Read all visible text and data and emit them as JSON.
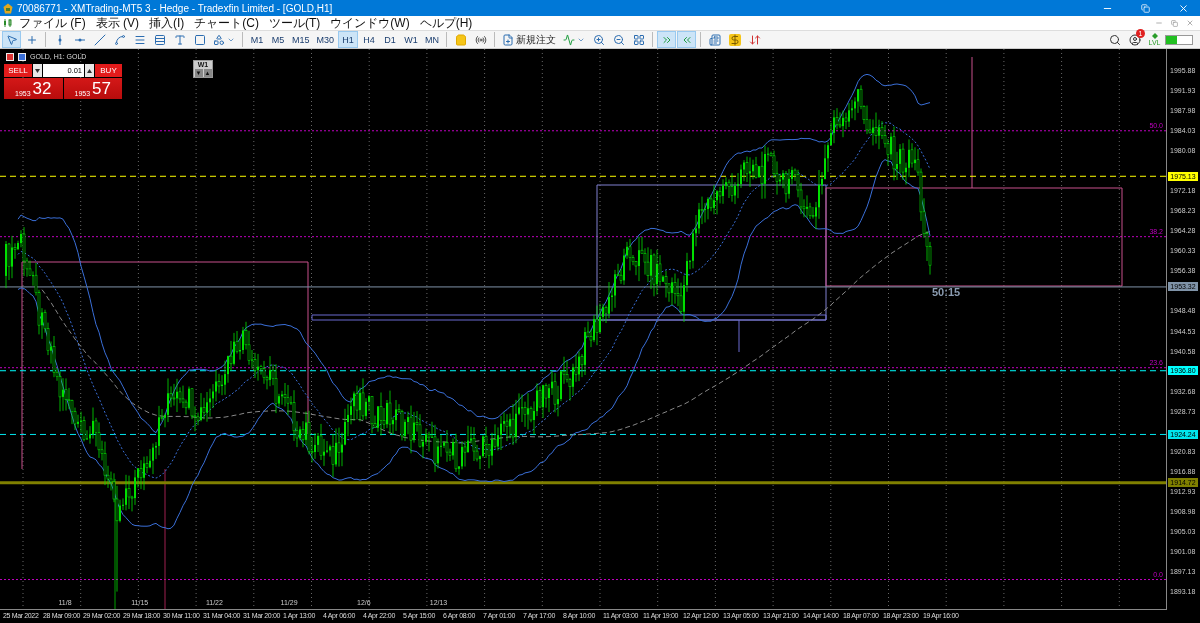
{
  "window": {
    "title": "70086771 - XMTrading-MT5 3 - Hedge - Tradexfin Limited - [GOLD,H1]"
  },
  "menu": [
    "ファイル (F)",
    "表示 (V)",
    "挿入(I)",
    "チャート(C)",
    "ツール(T)",
    "ウインドウ(W)",
    "ヘルプ(H)"
  ],
  "toolbar": {
    "tools": [
      {
        "kind": "cursor",
        "selected": true
      },
      {
        "kind": "crosshair",
        "selected": false
      },
      {
        "kind": "vertical-line",
        "selected": false
      },
      {
        "kind": "horizontal-line",
        "selected": false
      },
      {
        "kind": "trend-line",
        "selected": false
      },
      {
        "kind": "curve",
        "selected": false
      },
      {
        "kind": "channel",
        "selected": false
      },
      {
        "kind": "fibonacci",
        "selected": false
      },
      {
        "kind": "text",
        "selected": false
      },
      {
        "kind": "rectangle",
        "selected": false
      },
      {
        "kind": "shapes",
        "selected": false
      }
    ],
    "timeframes": [
      {
        "label": "M1",
        "selected": false
      },
      {
        "label": "M5",
        "selected": false
      },
      {
        "label": "M15",
        "selected": false
      },
      {
        "label": "M30",
        "selected": false
      },
      {
        "label": "H1",
        "selected": true
      },
      {
        "label": "H4",
        "selected": false
      },
      {
        "label": "D1",
        "selected": false
      },
      {
        "label": "W1",
        "selected": false
      },
      {
        "label": "MN",
        "selected": false
      }
    ],
    "new_order": "新規注文",
    "chart_tools": [
      {
        "kind": "auto-scroll",
        "selected": true
      },
      {
        "kind": "chart-shift",
        "selected": true
      }
    ],
    "notifications": "1",
    "lvl": "LVL"
  },
  "chart": {
    "header": "GOLD, H1: GOLD",
    "trade_panel": {
      "sell": "SELL",
      "buy": "BUY",
      "lot": "0.01",
      "sell_price": "1953",
      "sell_pips": "32",
      "buy_price": "1953",
      "buy_pips": "57"
    },
    "period_button": {
      "label": "W1",
      "down": "▼",
      "up": "▲"
    },
    "countdown": "50:15",
    "fibo_levels": [
      "50.0",
      "38.2",
      "23.6",
      "0.0"
    ],
    "price_lines": [
      {
        "label": "1975.13",
        "color": "#ffff00",
        "kind": "dashed"
      },
      {
        "label": "1953.32",
        "color": "#7f93a8",
        "kind": "solid"
      },
      {
        "label": "1936.80",
        "color": "#00ffff",
        "kind": "dashed"
      },
      {
        "label": "1924.24",
        "color": "#00e5ee",
        "kind": "dashed"
      },
      {
        "label": "1914.72",
        "color": "#808000",
        "kind": "thick"
      }
    ],
    "price_axis": [
      "1995.88",
      "1991.93",
      "1987.98",
      "1984.03",
      "1980.08",
      "1972.18",
      "1968.23",
      "1964.28",
      "1960.33",
      "1956.38",
      "1948.48",
      "1944.53",
      "1940.58",
      "1932.68",
      "1928.73",
      "1920.83",
      "1916.88",
      "1912.93",
      "1908.98",
      "1905.03",
      "1901.08",
      "1897.13",
      "1893.18"
    ],
    "period_separators": [
      "11/8",
      "11/15",
      "11/22",
      "11/29",
      "12/6",
      "12/13"
    ],
    "time_axis": [
      "25 Mar 2022",
      "28 Mar 09:00",
      "29 Mar 02:00",
      "29 Mar 18:00",
      "30 Mar 11:00",
      "31 Mar 04:00",
      "31 Mar 20:00",
      "1 Apr 13:00",
      "4 Apr 06:00",
      "4 Apr 22:00",
      "5 Apr 15:00",
      "6 Apr 08:00",
      "7 Apr 01:00",
      "7 Apr 17:00",
      "8 Apr 10:00",
      "11 Apr 03:00",
      "11 Apr 19:00",
      "12 Apr 12:00",
      "13 Apr 05:00",
      "13 Apr 21:00",
      "14 Apr 14:00",
      "18 Apr 07:00",
      "18 Apr 23:00",
      "19 Apr 16:00"
    ]
  }
}
